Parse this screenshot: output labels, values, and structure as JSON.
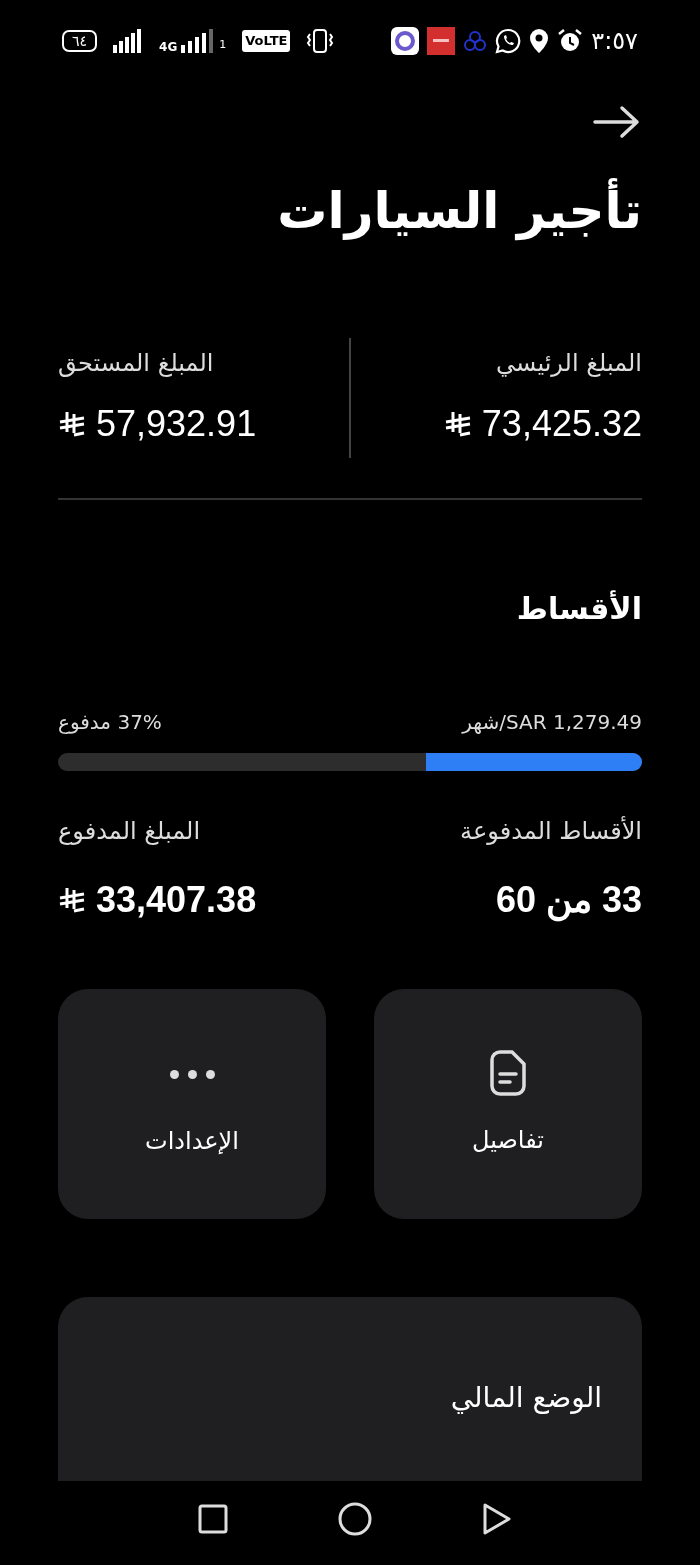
{
  "status_bar": {
    "time": "٣:٥٧",
    "battery": "٦٤",
    "network": "4G",
    "sim": "1",
    "volte": "VoLTE"
  },
  "title": "تأجير السيارات",
  "amounts": [
    {
      "label": "المبلغ الرئيسي",
      "value": "73,425.32"
    },
    {
      "label": "المبلغ المستحق",
      "value": "57,932.91"
    }
  ],
  "installments": {
    "heading": "الأقساط",
    "monthly": "شهر/SAR 1,279.49",
    "paid_percent": "37% مدفوع",
    "level": 0.37
  },
  "stats": [
    {
      "label": "الأقساط المدفوعة",
      "value": "33 من 60",
      "kind": "count"
    },
    {
      "label": "المبلغ المدفوع",
      "value": "33,407.38",
      "kind": "money"
    }
  ],
  "actions": [
    {
      "label": "تفاصيل",
      "kind": "details"
    },
    {
      "label": "الإعدادات",
      "kind": "more"
    }
  ],
  "panel": {
    "title": "الوضع المالي"
  }
}
